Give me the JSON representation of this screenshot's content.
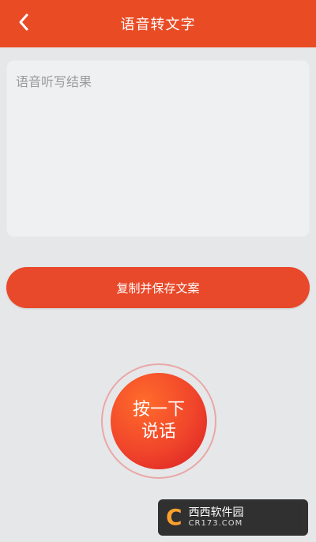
{
  "header": {
    "title": "语音转文字"
  },
  "result": {
    "placeholder": "语音听写结果"
  },
  "actions": {
    "copy_save_label": "复制并保存文案",
    "talk_line1": "按一下",
    "talk_line2": "说话"
  },
  "watermark": {
    "brand": "西西软件园",
    "site": "CR173.COM"
  },
  "colors": {
    "primary": "#e94b25",
    "background": "#e6e7e9",
    "card": "#eff0f2",
    "placeholder": "#9a9a9a"
  },
  "icons": {
    "back": "back-arrow-icon",
    "logo": "cr-logo-icon"
  }
}
